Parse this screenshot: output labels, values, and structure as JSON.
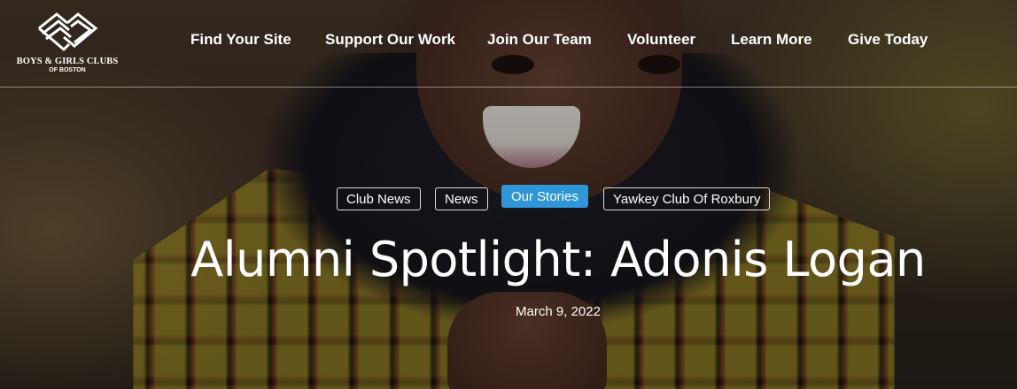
{
  "logo": {
    "line1": "BOYS & GIRLS CLUBS",
    "line2": "OF BOSTON"
  },
  "nav": {
    "items": [
      {
        "label": "Find Your Site"
      },
      {
        "label": "Support Our Work"
      },
      {
        "label": "Join Our Team"
      },
      {
        "label": "Volunteer"
      },
      {
        "label": "Learn More"
      },
      {
        "label": "Give Today"
      }
    ]
  },
  "tags": [
    {
      "label": "Club News",
      "active": false
    },
    {
      "label": "News",
      "active": false
    },
    {
      "label": "Our Stories",
      "active": true
    },
    {
      "label": "Yawkey Club Of Roxbury",
      "active": false
    }
  ],
  "article": {
    "title": "Alumni Spotlight: Adonis Logan",
    "date": "March 9, 2022"
  },
  "colors": {
    "active_tag": "#2f96d8",
    "text": "#ffffff"
  }
}
